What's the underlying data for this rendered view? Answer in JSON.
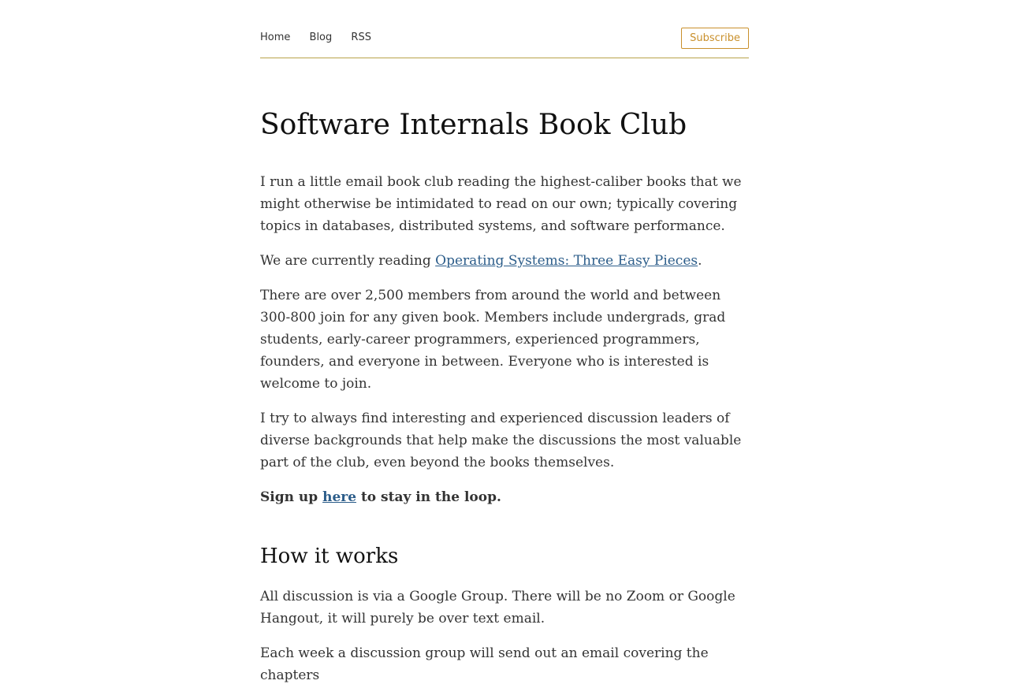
{
  "nav": {
    "links": [
      "Home",
      "Blog",
      "RSS"
    ],
    "subscribe_label": "Subscribe"
  },
  "page": {
    "title": "Software Internals Book Club",
    "intro": "I run a little email book club reading the highest-caliber books that we might otherwise be intimidated to read on our own; typically covering topics in databases, distributed systems, and software performance.",
    "currently_prefix": "We are currently reading ",
    "current_book_link": "Operating Systems: Three Easy Pieces",
    "currently_suffix": ".",
    "members": "There are over 2,500 members from around the world and between 300-800 join for any given book. Members include undergrads, grad students, early-career programmers, experienced programmers, founders, and everyone in between. Everyone who is interested is welcome to join.",
    "leaders": "I try to always find interesting and experienced discussion leaders of diverse backgrounds that help make the discussions the most valuable part of the club, even beyond the books themselves.",
    "signup_prefix": "Sign up ",
    "signup_link": "here",
    "signup_suffix": " to stay in the loop.",
    "how_heading": "How it works",
    "how_p1": "All discussion is via a Google Group. There will be no Zoom or Google Hangout, it will purely be over text email.",
    "how_p2_partial": "Each week a discussion group will send out an email covering the chapters"
  },
  "colors": {
    "link": "#2c5d8a",
    "accent": "#c9902c",
    "rule": "#b8a24a"
  }
}
